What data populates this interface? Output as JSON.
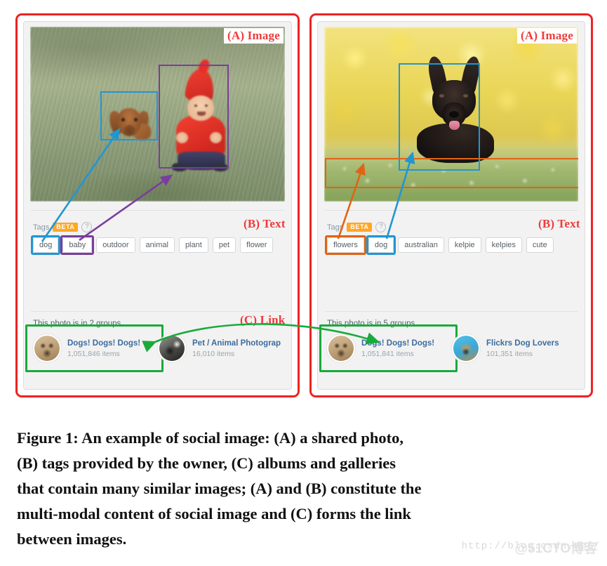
{
  "figure": {
    "caption_lines": [
      "Figure 1:  An example of social image: (A) a shared photo,",
      "(B) tags provided by the owner, (C) albums and galleries",
      "that contain many similar images; (A) and (B) constitute the",
      "multi-modal content of social image and (C) forms the link",
      "between images."
    ],
    "watermark": "http://blog.csdn.net/",
    "watermark_logo": "@51CTO博客",
    "annotation_colors": {
      "panel_border": "#ee2222",
      "label_text": "#ef3b3b",
      "blue_box": "#2196d4",
      "purple_box": "#7a3d9e",
      "orange_box": "#e06414",
      "green_box": "#1aaa3c"
    }
  },
  "labels": {
    "image": "(A) Image",
    "text": "(B) Text",
    "link": "(C) Link"
  },
  "left_panel": {
    "photo_alt": "puppy and toddler in red hooded suit sitting in grass",
    "tags": {
      "heading": "Tags",
      "badge": "BETA",
      "help": "?",
      "items": [
        {
          "label": "dog",
          "highlight": "blue"
        },
        {
          "label": "baby",
          "highlight": "purple"
        },
        {
          "label": "outdoor",
          "highlight": "none"
        },
        {
          "label": "animal",
          "highlight": "none"
        },
        {
          "label": "plant",
          "highlight": "none"
        },
        {
          "label": "pet",
          "highlight": "none"
        },
        {
          "label": "flower",
          "highlight": "none"
        }
      ]
    },
    "groups": {
      "title": "This photo is in 2 groups",
      "items": [
        {
          "name": "Dogs! Dogs! Dogs!",
          "count": "1,051,846 items",
          "avatar": "goldendoodle-avatar",
          "highlight": "green"
        },
        {
          "name": "Pet / Animal Photograp",
          "count": "16,010 items",
          "avatar": "bordercollie-avatar",
          "highlight": "none"
        }
      ]
    }
  },
  "right_panel": {
    "photo_alt": "black kelpie dog lying in a flower meadow with yellow blossom background",
    "tags": {
      "heading": "Tags",
      "badge": "BETA",
      "help": "?",
      "items": [
        {
          "label": "flowers",
          "highlight": "orange"
        },
        {
          "label": "dog",
          "highlight": "blue"
        },
        {
          "label": "australian",
          "highlight": "none"
        },
        {
          "label": "kelpie",
          "highlight": "none"
        },
        {
          "label": "kelpies",
          "highlight": "none"
        },
        {
          "label": "cute",
          "highlight": "none"
        }
      ]
    },
    "groups": {
      "title": "This photo is in 5 groups",
      "items": [
        {
          "name": "Dogs! Dogs! Dogs!",
          "count": "1,051,841 items",
          "avatar": "goldendoodle-avatar",
          "highlight": "green"
        },
        {
          "name": "Flickrs Dog Lovers",
          "count": "101,351 items",
          "avatar": "bluebg-dog-avatar",
          "highlight": "none"
        }
      ]
    }
  }
}
